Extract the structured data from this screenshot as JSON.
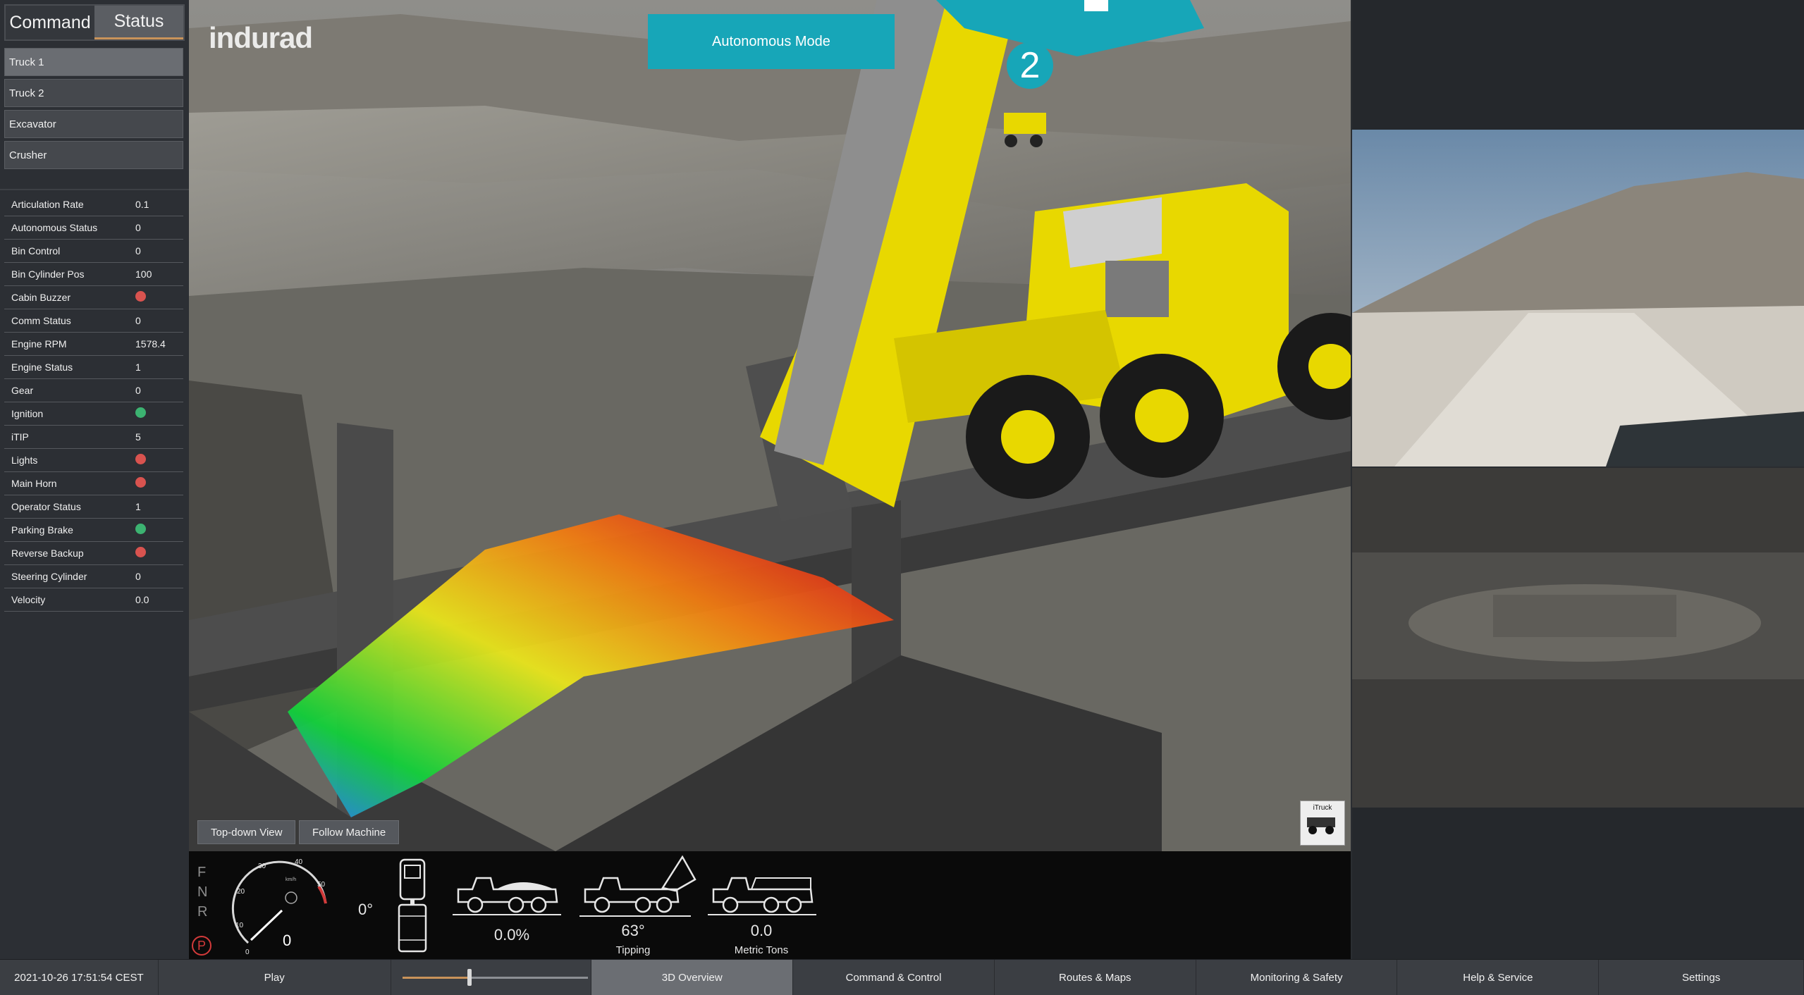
{
  "tabs": [
    {
      "label": "Command",
      "active": false
    },
    {
      "label": "Status",
      "active": true
    }
  ],
  "machines": [
    {
      "label": "Truck 1",
      "selected": true
    },
    {
      "label": "Truck 2",
      "selected": false
    },
    {
      "label": "Excavator",
      "selected": false
    },
    {
      "label": "Crusher",
      "selected": false
    }
  ],
  "status": [
    {
      "key": "Articulation Rate",
      "value": "0.1",
      "indicator": null
    },
    {
      "key": "Autonomous Status",
      "value": "0",
      "indicator": null
    },
    {
      "key": "Bin Control",
      "value": "0",
      "indicator": null
    },
    {
      "key": "Bin Cylinder Pos",
      "value": "100",
      "indicator": null
    },
    {
      "key": "Cabin Buzzer",
      "value": "",
      "indicator": "#d9534f"
    },
    {
      "key": "Comm Status",
      "value": "0",
      "indicator": null
    },
    {
      "key": "Engine RPM",
      "value": "1578.4",
      "indicator": null
    },
    {
      "key": "Engine Status",
      "value": "1",
      "indicator": null
    },
    {
      "key": "Gear",
      "value": "0",
      "indicator": null
    },
    {
      "key": "Ignition",
      "value": "",
      "indicator": "#3cb371"
    },
    {
      "key": "iTIP",
      "value": "5",
      "indicator": null
    },
    {
      "key": "Lights",
      "value": "",
      "indicator": "#d9534f"
    },
    {
      "key": "Main Horn",
      "value": "",
      "indicator": "#d9534f"
    },
    {
      "key": "Operator Status",
      "value": "1",
      "indicator": null
    },
    {
      "key": "Parking Brake",
      "value": "",
      "indicator": "#3cb371"
    },
    {
      "key": "Reverse Backup",
      "value": "",
      "indicator": "#d9534f"
    },
    {
      "key": "Steering Cylinder",
      "value": "0",
      "indicator": null
    },
    {
      "key": "Velocity",
      "value": "0.0",
      "indicator": null
    }
  ],
  "view": {
    "logo": "indurad",
    "mode_button": "Autonomous Mode",
    "machine_number": "2",
    "view_buttons": [
      "Top-down View",
      "Follow Machine"
    ],
    "thumbnail_label": "iTruck"
  },
  "dashboard": {
    "gears": [
      "F",
      "N",
      "R"
    ],
    "park_symbol": "P",
    "speed_value": "0",
    "speed_unit": "km/h",
    "speed_ticks": [
      "0",
      "10",
      "20",
      "30",
      "40",
      "50"
    ],
    "steering_angle": "0°",
    "load_percent": "0.0%",
    "tipping_value": "63°",
    "tipping_label": "Tipping",
    "tons_value": "0.0",
    "tons_label": "Metric Tons"
  },
  "nav": {
    "datetime": "2021-10-26 17:51:54 CEST",
    "play": "Play",
    "playback_progress": 0.36,
    "items": [
      {
        "label": "3D Overview",
        "active": true
      },
      {
        "label": "Command & Control",
        "active": false
      },
      {
        "label": "Routes & Maps",
        "active": false
      },
      {
        "label": "Monitoring & Safety",
        "active": false
      },
      {
        "label": "Help & Service",
        "active": false
      },
      {
        "label": "Settings",
        "active": false
      }
    ]
  },
  "colors": {
    "accent": "#17a6b8",
    "truck_yellow": "#e8d800",
    "indicator_red": "#d9534f",
    "indicator_green": "#3cb371",
    "slider_fill": "#c9935a"
  }
}
